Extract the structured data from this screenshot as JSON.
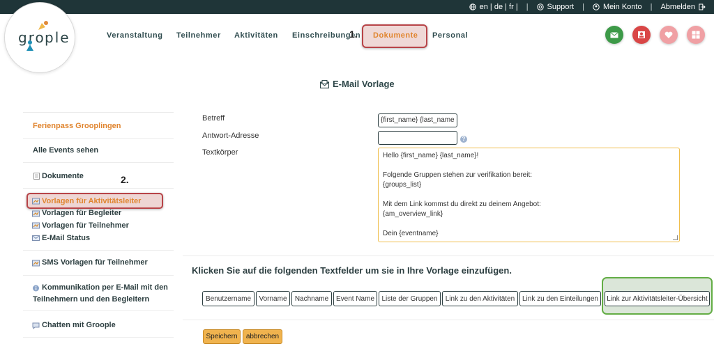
{
  "topbar": {
    "languages": "en | de | fr |",
    "support": "Support",
    "account": "Mein Konto",
    "logout": "Abmelden"
  },
  "logo": {
    "text_left": "gro",
    "text_right": "ple"
  },
  "nav": {
    "items": [
      "Veranstaltung",
      "Teilnehmer",
      "Aktivitäten",
      "Einschreibungen"
    ],
    "active": "Dokumente",
    "last": "Personal",
    "step1": "1.",
    "step2": "2."
  },
  "round_buttons": [
    {
      "icon": "mail-icon",
      "color": "#3d9a48"
    },
    {
      "icon": "user-card-icon",
      "color": "#d94646"
    },
    {
      "icon": "heart-icon",
      "color": "#f0a0a4"
    },
    {
      "icon": "grid-icon",
      "color": "#f0a0a4"
    }
  ],
  "page": {
    "title": "E-Mail Vorlage"
  },
  "sidebar": {
    "event": "Ferienpass Grooplingen",
    "all_events": "Alle Events sehen",
    "documents": "Dokumente",
    "templates_leader": "Vorlagen für Aktivitätsleiter",
    "templates_companion": "Vorlagen für Begleiter",
    "templates_participant": "Vorlagen für Teilnehmer",
    "email_status": "E-Mail Status",
    "sms_templates": "SMS Vorlagen für Teilnehmer",
    "communication_1": "Kommunikation per E-Mail mit den",
    "communication_2": "Teilnehmern und den Begleitern",
    "chat": "Chatten mit Groople"
  },
  "form": {
    "subject_label": "Betreff",
    "subject_value": "{first_name} {last_name",
    "reply_label": "Antwort-Adresse",
    "reply_value": "",
    "body_label": "Textkörper",
    "body_lines": [
      "Hello {first_name} {last_name}!",
      "",
      "Folgende Gruppen stehen zur verifikation bereit:",
      "{groups_list}",
      "",
      "Mit dem Link kommst du direkt zu deinem Angebot:",
      "{am_overview_link}",
      "",
      "Dein {eventname}"
    ]
  },
  "insert": {
    "heading": "Klicken Sie auf die folgenden Textfelder um sie in Ihre Vorlage einzufügen.",
    "tags": [
      "Benutzername",
      "Vorname",
      "Nachname",
      "Event Name",
      "Liste der Gruppen",
      "Link zu den Aktivitäten",
      "Link zu den Einteilungen",
      "Link zur Aktivitätsleiter-Übersicht"
    ]
  },
  "actions": {
    "save": "Speichern",
    "cancel": "abbrechen"
  }
}
